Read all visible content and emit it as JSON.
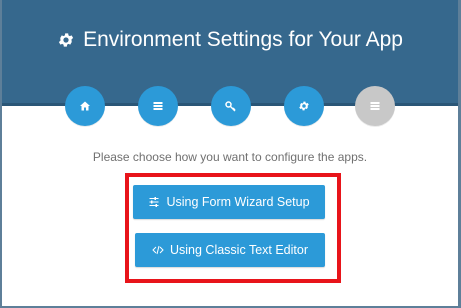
{
  "header": {
    "title": "Environment Settings for Your App",
    "title_icon": "gear-icon"
  },
  "steps": [
    {
      "icon": "home-icon",
      "state": "active"
    },
    {
      "icon": "list-icon",
      "state": "active"
    },
    {
      "icon": "key-icon",
      "state": "active"
    },
    {
      "icon": "gear-icon",
      "state": "active"
    },
    {
      "icon": "list-icon",
      "state": "inactive"
    }
  ],
  "main": {
    "prompt": "Please choose how you want to configure the apps.",
    "wizard_button": {
      "label": "Using Form Wizard Setup",
      "icon": "sliders-icon"
    },
    "editor_button": {
      "label": "Using Classic Text Editor",
      "icon": "code-icon"
    }
  },
  "colors": {
    "header_bg": "#36688d",
    "accent": "#2c9ad8",
    "inactive_step": "#c8c8c8",
    "highlight_border": "#e8141a"
  }
}
